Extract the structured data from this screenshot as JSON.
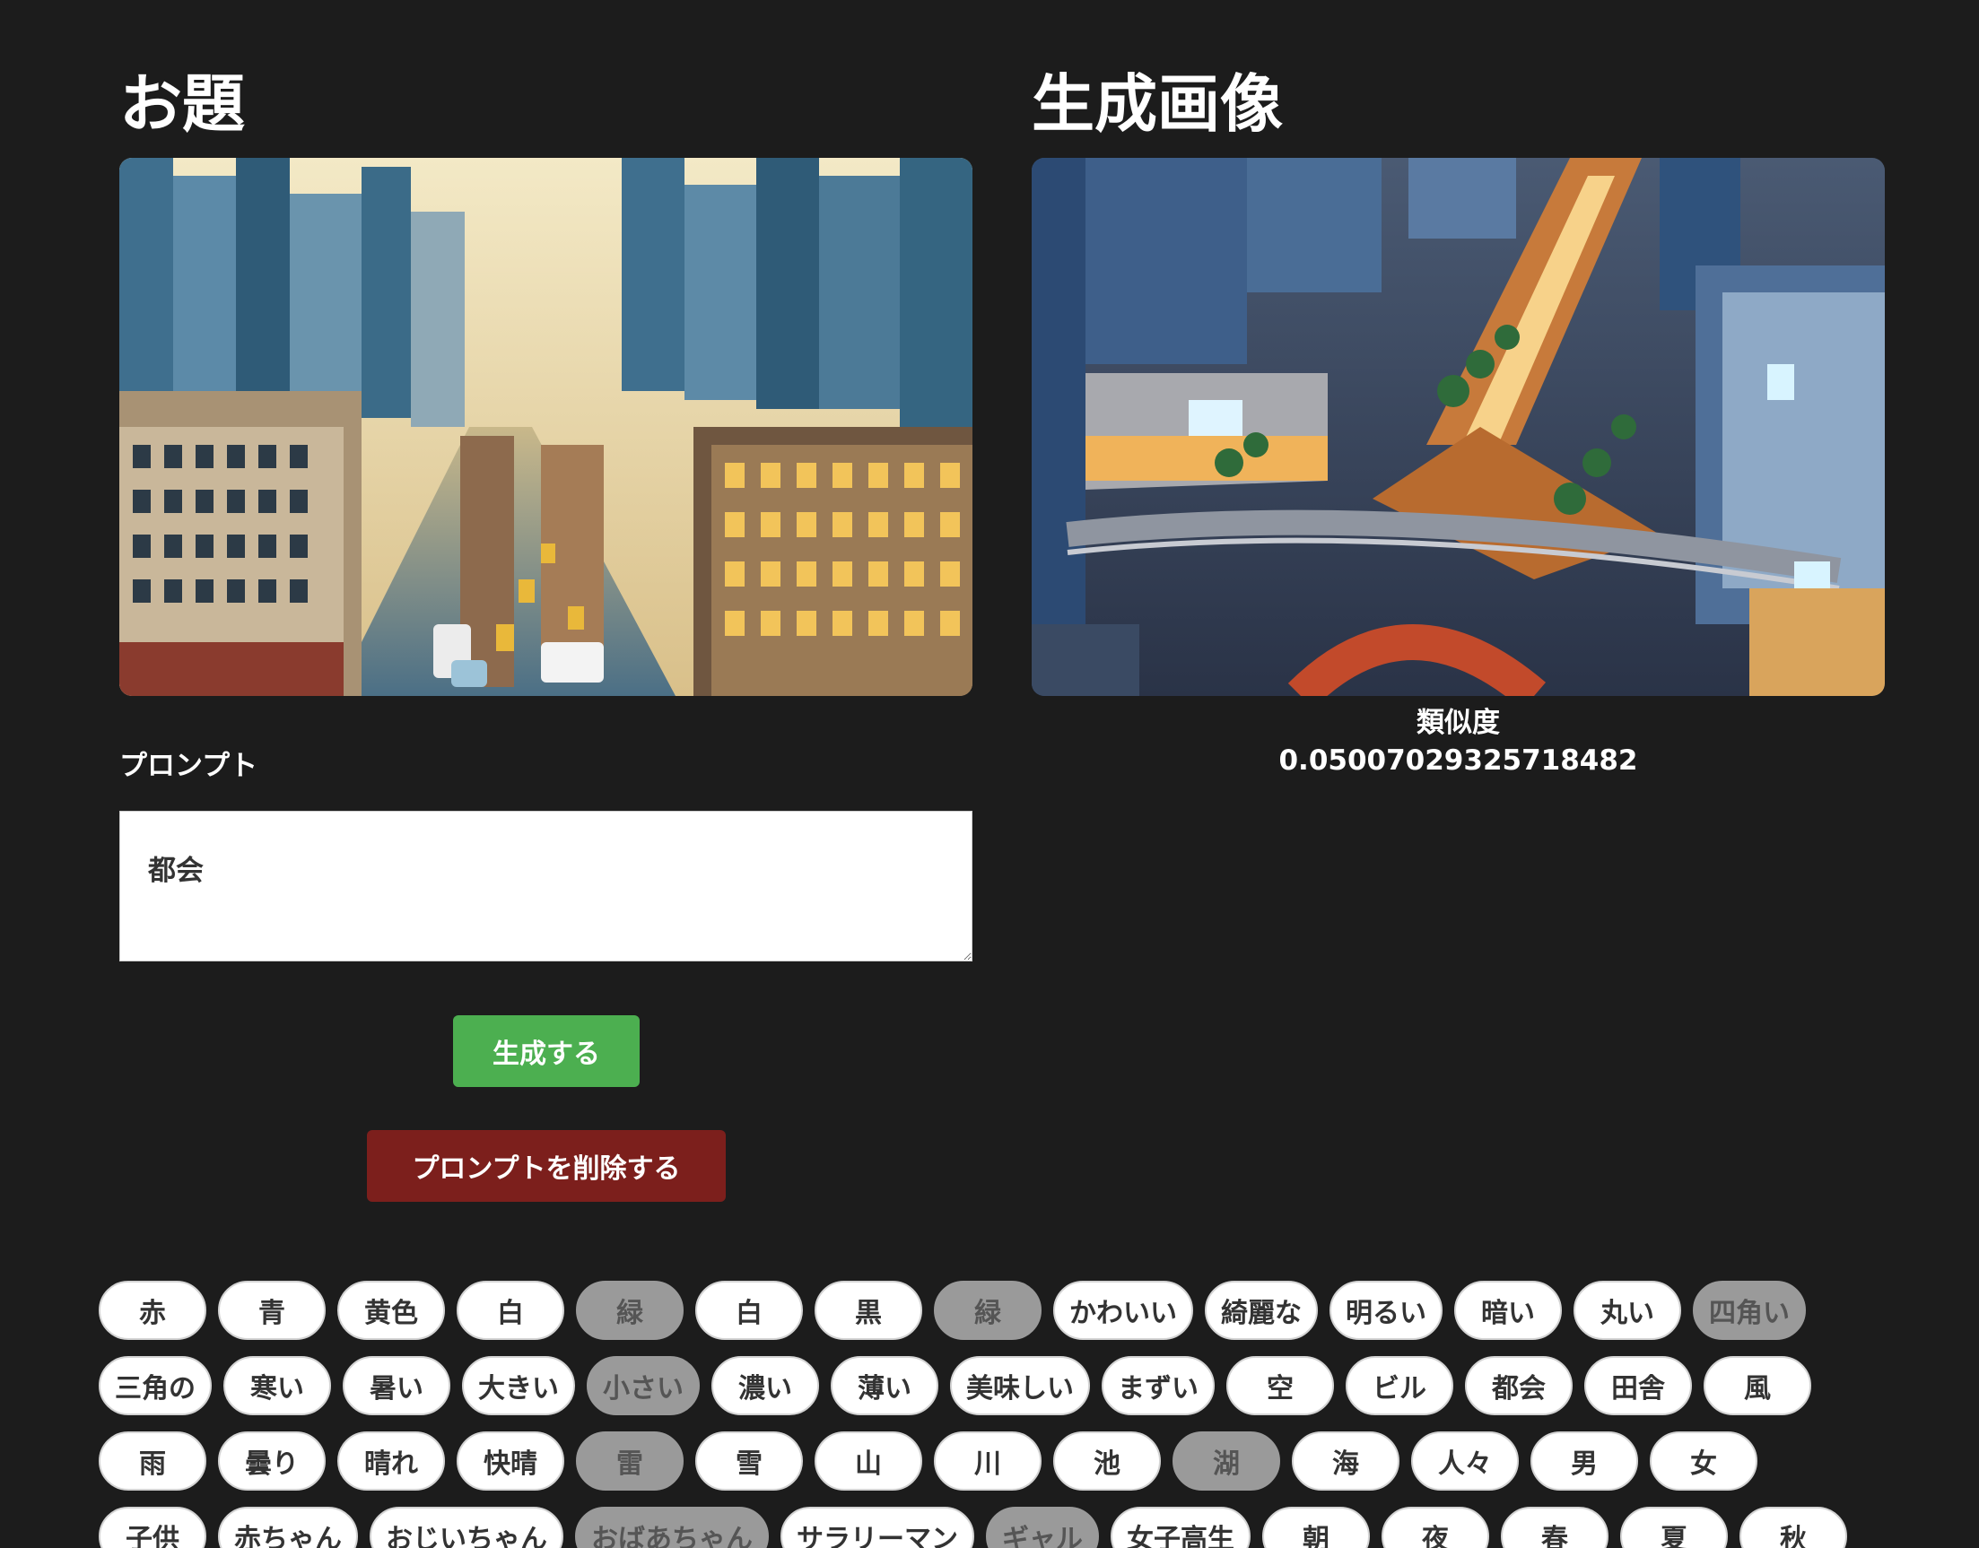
{
  "left_heading": "お題",
  "right_heading": "生成画像",
  "prompt_label": "プロンプト",
  "prompt_value": "都会",
  "similarity_label": "類似度",
  "similarity_value": "0.05007029325718482",
  "buttons": {
    "generate": "生成する",
    "delete": "プロンプトを削除する"
  },
  "colors": {
    "background": "#1c1c1c",
    "generate": "#4caf50",
    "delete": "#7c1f1c",
    "chip_selected": "#9a9a9a"
  },
  "chip_rows": [
    [
      {
        "label": "赤",
        "selected": false
      },
      {
        "label": "青",
        "selected": false
      },
      {
        "label": "黄色",
        "selected": false
      },
      {
        "label": "白",
        "selected": false
      },
      {
        "label": "緑",
        "selected": true
      },
      {
        "label": "白",
        "selected": false
      },
      {
        "label": "黒",
        "selected": false
      },
      {
        "label": "緑",
        "selected": true
      },
      {
        "label": "かわいい",
        "selected": false
      },
      {
        "label": "綺麗な",
        "selected": false
      },
      {
        "label": "明るい",
        "selected": false
      },
      {
        "label": "暗い",
        "selected": false
      },
      {
        "label": "丸い",
        "selected": false
      },
      {
        "label": "四角い",
        "selected": true
      }
    ],
    [
      {
        "label": "三角の",
        "selected": false
      },
      {
        "label": "寒い",
        "selected": false
      },
      {
        "label": "暑い",
        "selected": false
      },
      {
        "label": "大きい",
        "selected": false
      },
      {
        "label": "小さい",
        "selected": true
      },
      {
        "label": "濃い",
        "selected": false
      },
      {
        "label": "薄い",
        "selected": false
      },
      {
        "label": "美味しい",
        "selected": false
      },
      {
        "label": "まずい",
        "selected": false
      },
      {
        "label": "空",
        "selected": false
      },
      {
        "label": "ビル",
        "selected": false
      },
      {
        "label": "都会",
        "selected": false
      },
      {
        "label": "田舎",
        "selected": false
      },
      {
        "label": "風",
        "selected": false
      }
    ],
    [
      {
        "label": "雨",
        "selected": false
      },
      {
        "label": "曇り",
        "selected": false
      },
      {
        "label": "晴れ",
        "selected": false
      },
      {
        "label": "快晴",
        "selected": false
      },
      {
        "label": "雷",
        "selected": true
      },
      {
        "label": "雪",
        "selected": false
      },
      {
        "label": "山",
        "selected": false
      },
      {
        "label": "川",
        "selected": false
      },
      {
        "label": "池",
        "selected": false
      },
      {
        "label": "湖",
        "selected": true
      },
      {
        "label": "海",
        "selected": false
      },
      {
        "label": "人々",
        "selected": false
      },
      {
        "label": "男",
        "selected": false
      },
      {
        "label": "女",
        "selected": false
      }
    ],
    [
      {
        "label": "子供",
        "selected": false
      },
      {
        "label": "赤ちゃん",
        "selected": false
      },
      {
        "label": "おじいちゃん",
        "selected": false
      },
      {
        "label": "おばあちゃん",
        "selected": true
      },
      {
        "label": "サラリーマン",
        "selected": false
      },
      {
        "label": "ギャル",
        "selected": true
      },
      {
        "label": "女子高生",
        "selected": false
      },
      {
        "label": "朝",
        "selected": false
      },
      {
        "label": "夜",
        "selected": false
      },
      {
        "label": "春",
        "selected": false
      },
      {
        "label": "夏",
        "selected": false
      },
      {
        "label": "秋",
        "selected": false
      }
    ]
  ]
}
